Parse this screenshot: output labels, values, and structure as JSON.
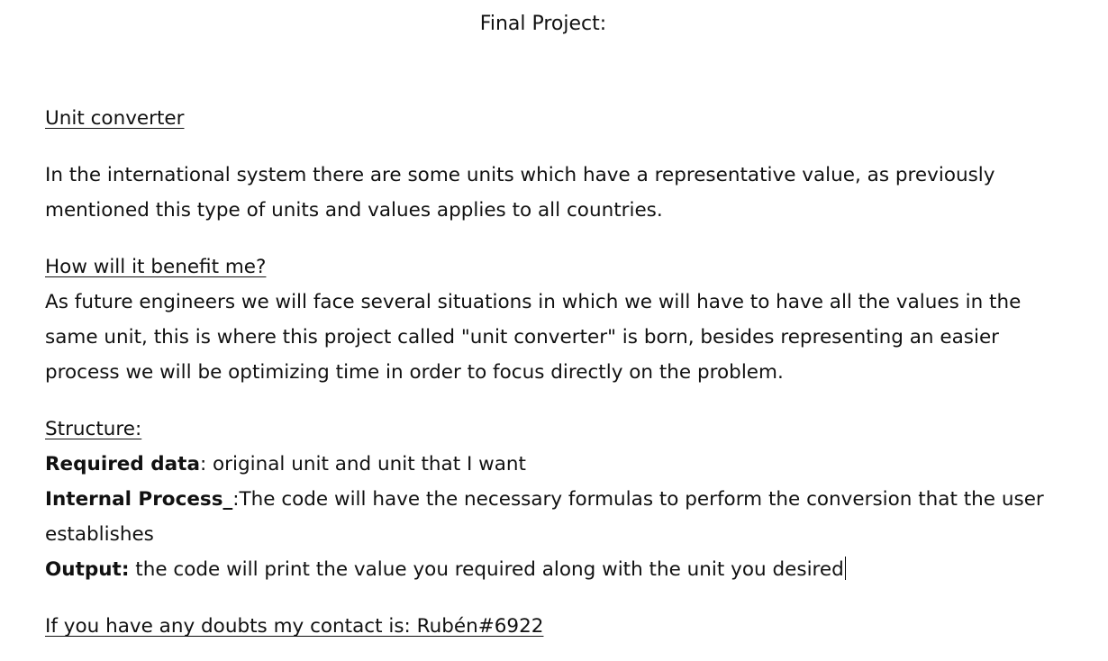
{
  "document": {
    "title": "Final Project:",
    "section1": {
      "heading": "Unit converter",
      "body": "In the international system there are some units which have a representative value, as previously mentioned this type of units and values applies to all countries."
    },
    "section2": {
      "heading": "How will it benefit me?",
      "body": "As future engineers we will face several situations in which we will have to have all the values in the same unit, this is where this project called \"unit converter\" is born, besides representing an easier process we will be optimizing time in order to focus directly on the problem."
    },
    "section3": {
      "heading": "Structure:",
      "required_label": "Required data",
      "required_text": ": original unit and unit that I want",
      "process_label": "Internal Process_",
      "process_text": ":The code will have the necessary formulas to perform the conversion that the user establishes",
      "output_label": "Output:",
      "output_text": " the code will print the value you required along with the unit you desired"
    },
    "contact": "If you have any doubts my contact is: Rubén#6922"
  }
}
